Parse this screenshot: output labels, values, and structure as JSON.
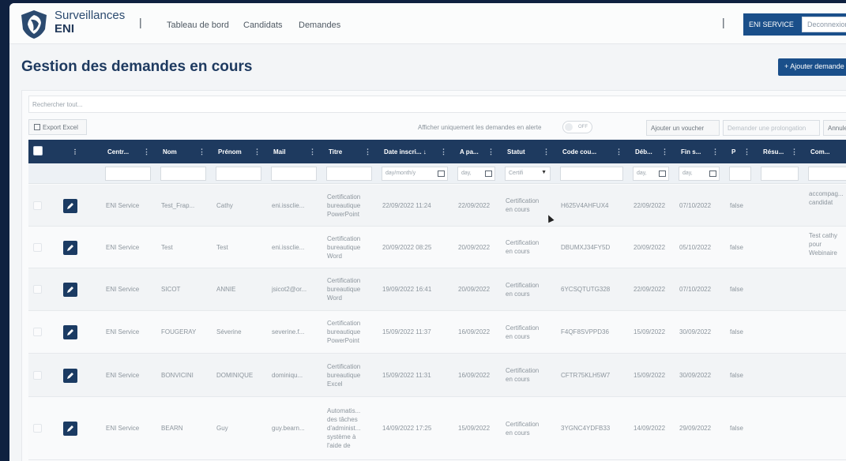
{
  "brand": {
    "line1": "Surveillances",
    "line2": "ENI"
  },
  "nav": {
    "sep": "|",
    "items": [
      "Tableau de bord",
      "Candidats",
      "Demandes"
    ]
  },
  "account": {
    "service": "ENI SERVICE",
    "logout": "Deconnexion"
  },
  "page": {
    "title": "Gestion des demandes en cours",
    "add_button": "+ Ajouter demande"
  },
  "toolbar": {
    "search_placeholder": "Rechercher tout...",
    "export": "Export Excel",
    "alert_label": "Afficher uniquement les demandes en alerte",
    "toggle_state": "OFF",
    "voucher": "Ajouter un voucher",
    "prolong": "Demander une prolongation",
    "cancel": "Annuler"
  },
  "columns": [
    "Centr...",
    "Nom",
    "Prénom",
    "Mail",
    "Titre",
    "Date inscri... ↓",
    "A pa...",
    "Statut",
    "Code cou...",
    "Déb...",
    "Fin s...",
    "P",
    "Résu...",
    "Com..."
  ],
  "column_menu_icon": "⋮",
  "filters": {
    "date_inscription": "day/month/y",
    "a_partir": "day,",
    "statut": "Certifi",
    "debut": "day,",
    "fin": "day,"
  },
  "rows": [
    {
      "centre": "ENI Service",
      "nom": "Test_Frap...",
      "prenom": "Cathy",
      "mail": "eni.issclie...",
      "titre": [
        "Certification",
        "bureautique",
        "PowerPoint"
      ],
      "date_inscription": "22/09/2022 11:24",
      "a_partir": "22/09/2022",
      "statut": [
        "Certification",
        "en cours"
      ],
      "code": "H625V4AHFUX4",
      "debut": "22/09/2022",
      "fin": "07/10/2022",
      "p": "false",
      "resume": "",
      "commentaire": [
        "accompag...",
        "candidat"
      ]
    },
    {
      "centre": "ENI Service",
      "nom": "Test",
      "prenom": "Test",
      "mail": "eni.issclie...",
      "titre": [
        "Certification",
        "bureautique",
        "Word"
      ],
      "date_inscription": "20/09/2022 08:25",
      "a_partir": "20/09/2022",
      "statut": [
        "Certification",
        "en cours"
      ],
      "code": "DBUMXJ34FY5D",
      "debut": "20/09/2022",
      "fin": "05/10/2022",
      "p": "false",
      "resume": "",
      "commentaire": [
        "Test cathy",
        "pour",
        "Webinaire"
      ]
    },
    {
      "centre": "ENI Service",
      "nom": "SICOT",
      "prenom": "ANNIE",
      "mail": "jsicot2@or...",
      "titre": [
        "Certification",
        "bureautique",
        "Word"
      ],
      "date_inscription": "19/09/2022 16:41",
      "a_partir": "20/09/2022",
      "statut": [
        "Certification",
        "en cours"
      ],
      "code": "6YCSQTUTG328",
      "debut": "22/09/2022",
      "fin": "07/10/2022",
      "p": "false",
      "resume": "",
      "commentaire": []
    },
    {
      "centre": "ENI Service",
      "nom": "FOUGERAY",
      "prenom": "Séverine",
      "mail": "severine.f...",
      "titre": [
        "Certification",
        "bureautique",
        "PowerPoint"
      ],
      "date_inscription": "15/09/2022 11:37",
      "a_partir": "16/09/2022",
      "statut": [
        "Certification",
        "en cours"
      ],
      "code": "F4QF8SVPPD36",
      "debut": "15/09/2022",
      "fin": "30/09/2022",
      "p": "false",
      "resume": "",
      "commentaire": []
    },
    {
      "centre": "ENI Service",
      "nom": "BONVICINI",
      "prenom": "DOMINIQUE",
      "mail": "dominiqu...",
      "titre": [
        "Certification",
        "bureautique",
        "Excel"
      ],
      "date_inscription": "15/09/2022 11:31",
      "a_partir": "16/09/2022",
      "statut": [
        "Certification",
        "en cours"
      ],
      "code": "CFTR75KLH5W7",
      "debut": "15/09/2022",
      "fin": "30/09/2022",
      "p": "false",
      "resume": "",
      "commentaire": []
    },
    {
      "centre": "ENI Service",
      "nom": "BEARN",
      "prenom": "Guy",
      "mail": "guy.bearn...",
      "titre": [
        "Automatis...",
        "des tâches",
        "d'administ...",
        "système à",
        "l'aide de"
      ],
      "date_inscription": "14/09/2022 17:25",
      "a_partir": "15/09/2022",
      "statut": [
        "Certification",
        "en cours"
      ],
      "code": "3YGNC4YDFB33",
      "debut": "14/09/2022",
      "fin": "29/09/2022",
      "p": "false",
      "resume": "",
      "commentaire": []
    }
  ]
}
